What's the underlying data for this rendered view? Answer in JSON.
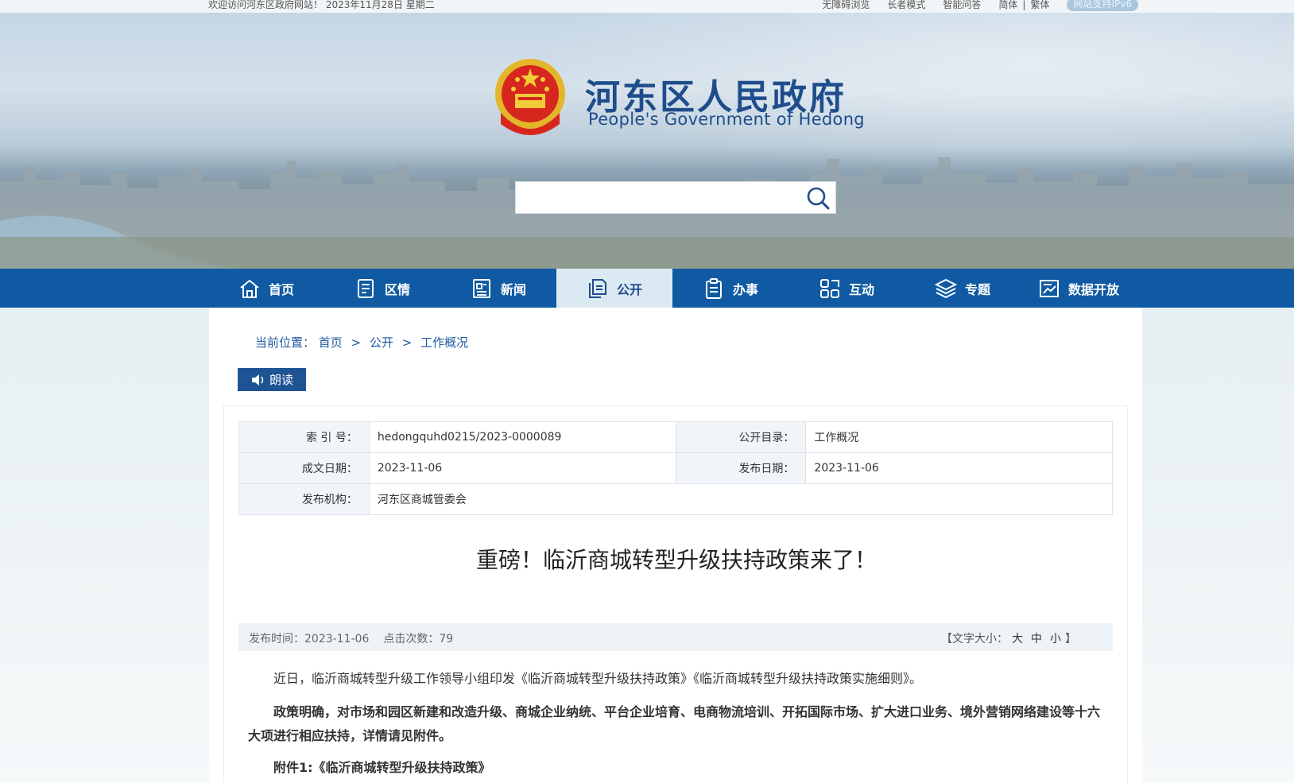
{
  "topbar": {
    "welcome": "欢迎访问河东区政府网站！ 2023年11月28日  星期二",
    "accessible": "无障碍浏览",
    "elder": "长者模式",
    "ai_qa": "智能问答",
    "simplified": "简体",
    "sep": "|",
    "traditional": "繁体",
    "ipv6": "网站支持IPv6"
  },
  "header": {
    "title": "河东区人民政府",
    "subtitle": "People's Government of Hedong",
    "search_placeholder": ""
  },
  "nav": {
    "items": [
      {
        "label": "首页",
        "icon": "home-icon"
      },
      {
        "label": "区情",
        "icon": "document-icon"
      },
      {
        "label": "新闻",
        "icon": "news-icon"
      },
      {
        "label": "公开",
        "icon": "files-icon"
      },
      {
        "label": "办事",
        "icon": "clipboard-icon"
      },
      {
        "label": "互动",
        "icon": "interact-icon"
      },
      {
        "label": "专题",
        "icon": "layers-icon"
      },
      {
        "label": "数据开放",
        "icon": "chart-icon"
      }
    ],
    "active_index": 3
  },
  "breadcrumb": {
    "prefix": "当前位置：",
    "items": [
      "首页",
      "公开",
      "工作概况"
    ],
    "sep": ">"
  },
  "read_button": "朗读",
  "meta": {
    "index_label": "索 引 号：",
    "index_value": "hedongquhd0215/2023-0000089",
    "catalog_label": "公开目录：",
    "catalog_value": "工作概况",
    "created_label": "成文日期：",
    "created_value": "2023-11-06",
    "published_label": "发布日期：",
    "published_value": "2023-11-06",
    "org_label": "发布机构：",
    "org_value": "河东区商城管委会"
  },
  "article": {
    "title": "重磅！临沂商城转型升级扶持政策来了！",
    "publish_time": "发布时间：2023-11-06",
    "clicks": "点击次数：79",
    "font_size_prefix": "【文字大小：",
    "font_large": "大",
    "font_medium": "中",
    "font_small": "小",
    "font_size_suffix": "】",
    "paragraphs": [
      "近日，临沂商城转型升级工作领导小组印发《临沂商城转型升级扶持政策》《临沂商城转型升级扶持政策实施细则》。",
      "政策明确，对市场和园区新建和改造升级、商城企业纳统、平台企业培育、电商物流培训、开拓国际市场、扩大进口业务、境外营销网络建设等十六大项进行相应扶持，详情请见附件。",
      "附件1:《临沂商城转型升级扶持政策》"
    ]
  },
  "colors": {
    "nav_bg": "#0f5aa3",
    "nav_active_bg": "#dbe9f2",
    "brand_blue": "#1f4d8c",
    "read_btn": "#1e5394"
  }
}
